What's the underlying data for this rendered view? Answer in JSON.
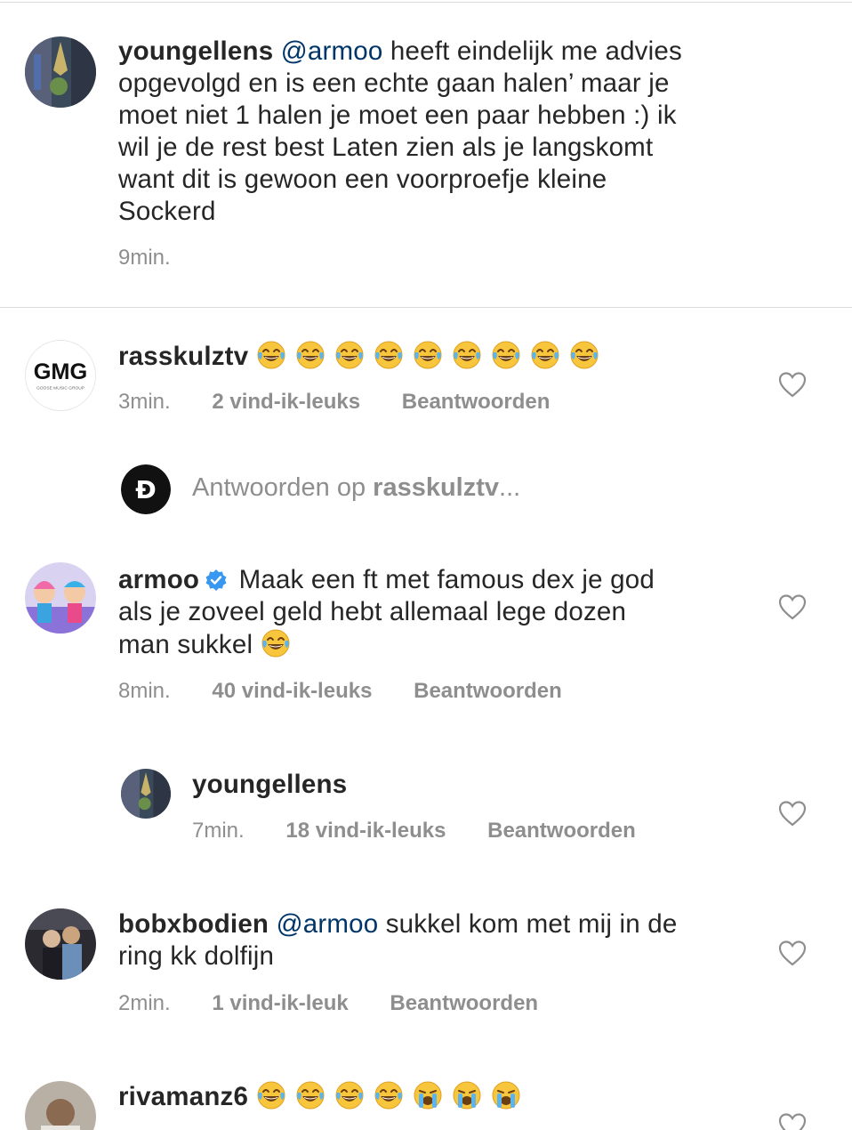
{
  "top_comment": {
    "username": "youngellens",
    "mention": "@armoo",
    "text_lines": [
      " heeft eindelijk me advies",
      "opgevolgd en is een echte gaan halen’ maar je",
      "moet niet 1 halen je moet een paar hebben :) ik",
      "wil je de rest best Laten zien als je langskomt",
      "want dit is gewoon een voorproefje kleine",
      "Sockerd"
    ],
    "time": "9min."
  },
  "comments": [
    {
      "username": "rasskulztv",
      "emojis": [
        "laugh-cry",
        "laugh-cry",
        "laugh-cry",
        "laugh-cry",
        "laugh-cry",
        "laugh-cry",
        "laugh-cry",
        "laugh-cry",
        "laugh-cry"
      ],
      "time": "3min.",
      "likes": "2 vind-ik-leuks",
      "reply": "Beantwoorden",
      "avatar_text": "GMG",
      "avatar_subtext": "GOOSE MUSIC GROUP"
    }
  ],
  "reply_input": {
    "placeholder_prefix": "Antwoorden op ",
    "placeholder_user": "rasskulztv",
    "placeholder_suffix": "..."
  },
  "reply_armoo": {
    "username": "armoo",
    "text_lines": [
      " Maak een ft met famous dex je god",
      "als je zoveel geld hebt allemaal lege dozen",
      "man sukkel "
    ],
    "time": "8min.",
    "likes": "40 vind-ik-leuks",
    "reply": "Beantwoorden"
  },
  "reply_youngellens": {
    "username": "youngellens",
    "time": "7min.",
    "likes": "18 vind-ik-leuks",
    "reply": "Beantwoorden"
  },
  "comment_bob": {
    "username": "bobxbodien",
    "mention": "@armoo",
    "text_lines": [
      " sukkel kom met mij in de",
      "ring kk dolfijn"
    ],
    "time": "2min.",
    "likes": "1 vind-ik-leuk",
    "reply": "Beantwoorden"
  },
  "comment_riva": {
    "username": "rivamanz6",
    "emojis": [
      "laugh-cry",
      "laugh-cry",
      "laugh-cry",
      "laugh-cry",
      "loud-cry",
      "loud-cry",
      "loud-cry"
    ]
  },
  "colors": {
    "text": "#262626",
    "muted": "#8e8e8e",
    "mention": "#003569",
    "verified": "#3897f0",
    "divider": "#dbdbdb"
  }
}
